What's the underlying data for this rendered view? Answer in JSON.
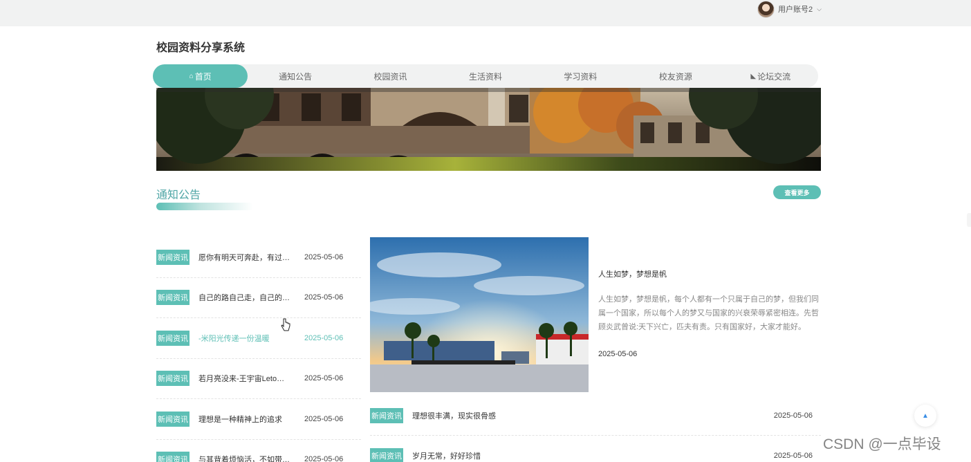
{
  "header": {
    "user_name": "用户账号2",
    "chevron": "⌵"
  },
  "site": {
    "title": "校园资料分享系统"
  },
  "nav": {
    "items": [
      {
        "label": "首页",
        "icon": "home-icon",
        "active": true
      },
      {
        "label": "通知公告"
      },
      {
        "label": "校园资讯"
      },
      {
        "label": "生活资料"
      },
      {
        "label": "学习资料"
      },
      {
        "label": "校友资源"
      },
      {
        "label": "论坛交流",
        "icon": "forum-icon"
      }
    ]
  },
  "section": {
    "title": "通知公告",
    "more_label": "查看更多"
  },
  "news_left": [
    {
      "tag": "新闻资讯",
      "title": "愿你有明天可奔赴，有过往可回首",
      "date": "2025-05-06"
    },
    {
      "tag": "新闻资讯",
      "title": "自己的路自己走，自己的选择自己承担",
      "date": "2025-05-06"
    },
    {
      "tag": "新闻资讯",
      "title": "-米阳光传递一份温暖",
      "date": "2025-05-06",
      "hover": true
    },
    {
      "tag": "新闻资讯",
      "title": "若月亮没来-王宇宙Leto，乔浚丞",
      "date": "2025-05-06"
    },
    {
      "tag": "新闻资讯",
      "title": "理想是一种精神上的追求",
      "date": "2025-05-06"
    },
    {
      "tag": "新闻资讯",
      "title": "与其背着烦恼活，不如带着微笑走",
      "date": "2025-05-06"
    }
  ],
  "feature": {
    "title": "人生如梦，梦想是帆",
    "body": "人生如梦，梦想是帆，每个人都有一个只属于自己的梦，但我们同属一个国家，所以每个人的梦又与国家的兴衰荣辱紧密相连。先哲顾炎武曾说:天下兴亡，匹夫有责。只有国家好，大家才能好。",
    "date": "2025-05-06"
  },
  "news_right": [
    {
      "tag": "新闻资讯",
      "title": "理想很丰满，现实很骨感",
      "date": "2025-05-06"
    },
    {
      "tag": "新闻资讯",
      "title": "岁月无常，好好珍惜",
      "date": "2025-05-06"
    }
  ],
  "icons": {
    "home": "⌂",
    "forum": "◣",
    "scroll_top": "▲"
  },
  "colors": {
    "accent": "#5dbfb5",
    "section_title": "#4fa6a6",
    "topbar": "#f1f2f2"
  },
  "watermark": "CSDN @一点毕设"
}
